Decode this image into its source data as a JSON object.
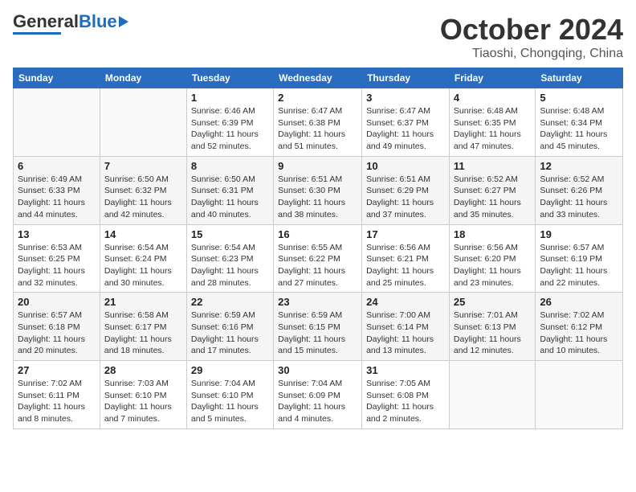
{
  "header": {
    "logo_general": "General",
    "logo_blue": "Blue",
    "title": "October 2024",
    "subtitle": "Tiaoshi, Chongqing, China"
  },
  "days_of_week": [
    "Sunday",
    "Monday",
    "Tuesday",
    "Wednesday",
    "Thursday",
    "Friday",
    "Saturday"
  ],
  "weeks": [
    [
      {
        "day": null
      },
      {
        "day": null
      },
      {
        "day": "1",
        "sunrise": "Sunrise: 6:46 AM",
        "sunset": "Sunset: 6:39 PM",
        "daylight": "Daylight: 11 hours and 52 minutes."
      },
      {
        "day": "2",
        "sunrise": "Sunrise: 6:47 AM",
        "sunset": "Sunset: 6:38 PM",
        "daylight": "Daylight: 11 hours and 51 minutes."
      },
      {
        "day": "3",
        "sunrise": "Sunrise: 6:47 AM",
        "sunset": "Sunset: 6:37 PM",
        "daylight": "Daylight: 11 hours and 49 minutes."
      },
      {
        "day": "4",
        "sunrise": "Sunrise: 6:48 AM",
        "sunset": "Sunset: 6:35 PM",
        "daylight": "Daylight: 11 hours and 47 minutes."
      },
      {
        "day": "5",
        "sunrise": "Sunrise: 6:48 AM",
        "sunset": "Sunset: 6:34 PM",
        "daylight": "Daylight: 11 hours and 45 minutes."
      }
    ],
    [
      {
        "day": "6",
        "sunrise": "Sunrise: 6:49 AM",
        "sunset": "Sunset: 6:33 PM",
        "daylight": "Daylight: 11 hours and 44 minutes."
      },
      {
        "day": "7",
        "sunrise": "Sunrise: 6:50 AM",
        "sunset": "Sunset: 6:32 PM",
        "daylight": "Daylight: 11 hours and 42 minutes."
      },
      {
        "day": "8",
        "sunrise": "Sunrise: 6:50 AM",
        "sunset": "Sunset: 6:31 PM",
        "daylight": "Daylight: 11 hours and 40 minutes."
      },
      {
        "day": "9",
        "sunrise": "Sunrise: 6:51 AM",
        "sunset": "Sunset: 6:30 PM",
        "daylight": "Daylight: 11 hours and 38 minutes."
      },
      {
        "day": "10",
        "sunrise": "Sunrise: 6:51 AM",
        "sunset": "Sunset: 6:29 PM",
        "daylight": "Daylight: 11 hours and 37 minutes."
      },
      {
        "day": "11",
        "sunrise": "Sunrise: 6:52 AM",
        "sunset": "Sunset: 6:27 PM",
        "daylight": "Daylight: 11 hours and 35 minutes."
      },
      {
        "day": "12",
        "sunrise": "Sunrise: 6:52 AM",
        "sunset": "Sunset: 6:26 PM",
        "daylight": "Daylight: 11 hours and 33 minutes."
      }
    ],
    [
      {
        "day": "13",
        "sunrise": "Sunrise: 6:53 AM",
        "sunset": "Sunset: 6:25 PM",
        "daylight": "Daylight: 11 hours and 32 minutes."
      },
      {
        "day": "14",
        "sunrise": "Sunrise: 6:54 AM",
        "sunset": "Sunset: 6:24 PM",
        "daylight": "Daylight: 11 hours and 30 minutes."
      },
      {
        "day": "15",
        "sunrise": "Sunrise: 6:54 AM",
        "sunset": "Sunset: 6:23 PM",
        "daylight": "Daylight: 11 hours and 28 minutes."
      },
      {
        "day": "16",
        "sunrise": "Sunrise: 6:55 AM",
        "sunset": "Sunset: 6:22 PM",
        "daylight": "Daylight: 11 hours and 27 minutes."
      },
      {
        "day": "17",
        "sunrise": "Sunrise: 6:56 AM",
        "sunset": "Sunset: 6:21 PM",
        "daylight": "Daylight: 11 hours and 25 minutes."
      },
      {
        "day": "18",
        "sunrise": "Sunrise: 6:56 AM",
        "sunset": "Sunset: 6:20 PM",
        "daylight": "Daylight: 11 hours and 23 minutes."
      },
      {
        "day": "19",
        "sunrise": "Sunrise: 6:57 AM",
        "sunset": "Sunset: 6:19 PM",
        "daylight": "Daylight: 11 hours and 22 minutes."
      }
    ],
    [
      {
        "day": "20",
        "sunrise": "Sunrise: 6:57 AM",
        "sunset": "Sunset: 6:18 PM",
        "daylight": "Daylight: 11 hours and 20 minutes."
      },
      {
        "day": "21",
        "sunrise": "Sunrise: 6:58 AM",
        "sunset": "Sunset: 6:17 PM",
        "daylight": "Daylight: 11 hours and 18 minutes."
      },
      {
        "day": "22",
        "sunrise": "Sunrise: 6:59 AM",
        "sunset": "Sunset: 6:16 PM",
        "daylight": "Daylight: 11 hours and 17 minutes."
      },
      {
        "day": "23",
        "sunrise": "Sunrise: 6:59 AM",
        "sunset": "Sunset: 6:15 PM",
        "daylight": "Daylight: 11 hours and 15 minutes."
      },
      {
        "day": "24",
        "sunrise": "Sunrise: 7:00 AM",
        "sunset": "Sunset: 6:14 PM",
        "daylight": "Daylight: 11 hours and 13 minutes."
      },
      {
        "day": "25",
        "sunrise": "Sunrise: 7:01 AM",
        "sunset": "Sunset: 6:13 PM",
        "daylight": "Daylight: 11 hours and 12 minutes."
      },
      {
        "day": "26",
        "sunrise": "Sunrise: 7:02 AM",
        "sunset": "Sunset: 6:12 PM",
        "daylight": "Daylight: 11 hours and 10 minutes."
      }
    ],
    [
      {
        "day": "27",
        "sunrise": "Sunrise: 7:02 AM",
        "sunset": "Sunset: 6:11 PM",
        "daylight": "Daylight: 11 hours and 8 minutes."
      },
      {
        "day": "28",
        "sunrise": "Sunrise: 7:03 AM",
        "sunset": "Sunset: 6:10 PM",
        "daylight": "Daylight: 11 hours and 7 minutes."
      },
      {
        "day": "29",
        "sunrise": "Sunrise: 7:04 AM",
        "sunset": "Sunset: 6:10 PM",
        "daylight": "Daylight: 11 hours and 5 minutes."
      },
      {
        "day": "30",
        "sunrise": "Sunrise: 7:04 AM",
        "sunset": "Sunset: 6:09 PM",
        "daylight": "Daylight: 11 hours and 4 minutes."
      },
      {
        "day": "31",
        "sunrise": "Sunrise: 7:05 AM",
        "sunset": "Sunset: 6:08 PM",
        "daylight": "Daylight: 11 hours and 2 minutes."
      },
      {
        "day": null
      },
      {
        "day": null
      }
    ]
  ]
}
